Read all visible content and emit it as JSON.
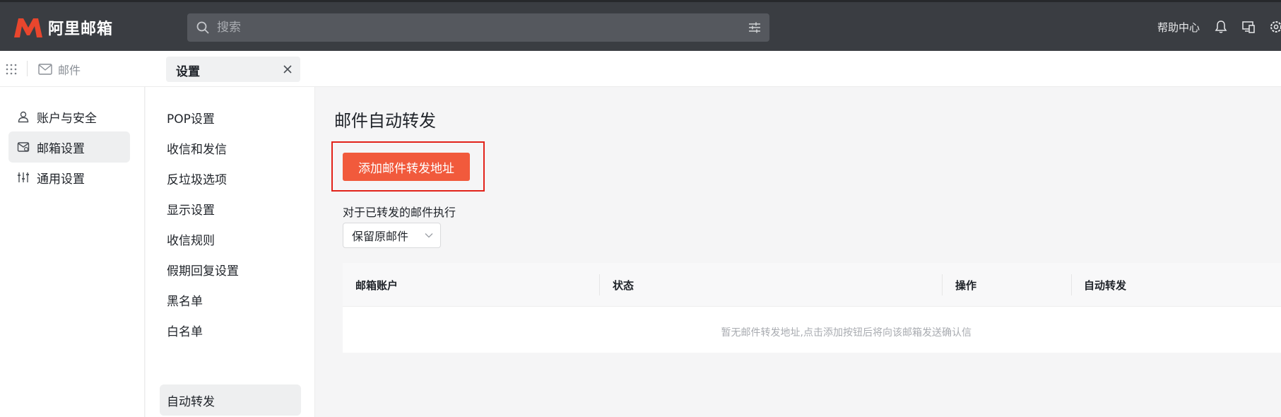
{
  "app": {
    "name": "阿里邮箱",
    "brand_color": "#e8462d"
  },
  "topbar": {
    "search_placeholder": "搜索",
    "help_label": "帮助中心",
    "icons": [
      "search-icon",
      "filter-icon",
      "bell-icon",
      "devices-icon",
      "gear-icon"
    ]
  },
  "tabs": {
    "mail_label": "邮件",
    "settings_label": "设置"
  },
  "sidebar": {
    "items": [
      {
        "label": "账户与安全",
        "icon": "user-icon"
      },
      {
        "label": "邮箱设置",
        "icon": "mailbox-settings-icon",
        "active": true
      },
      {
        "label": "通用设置",
        "icon": "sliders-icon"
      }
    ]
  },
  "subnav": {
    "items": [
      {
        "label": "POP设置"
      },
      {
        "label": "收信和发信"
      },
      {
        "label": "反垃圾选项"
      },
      {
        "label": "显示设置"
      },
      {
        "label": "收信规则"
      },
      {
        "label": "假期回复设置"
      },
      {
        "label": "黑名单"
      },
      {
        "label": "白名单"
      },
      {
        "label": "自动转发",
        "active": true
      }
    ]
  },
  "main": {
    "title": "邮件自动转发",
    "add_button_label": "添加邮件转发地址",
    "exec_label": "对于已转发的邮件执行",
    "exec_select_value": "保留原邮件",
    "table": {
      "headers": [
        "邮箱账户",
        "状态",
        "操作",
        "自动转发"
      ],
      "empty_text": "暂无邮件转发地址,点击添加按钮后将向该邮箱发送确认信"
    },
    "accent_color": "#f15a3c",
    "highlight_color": "#e2231a"
  }
}
